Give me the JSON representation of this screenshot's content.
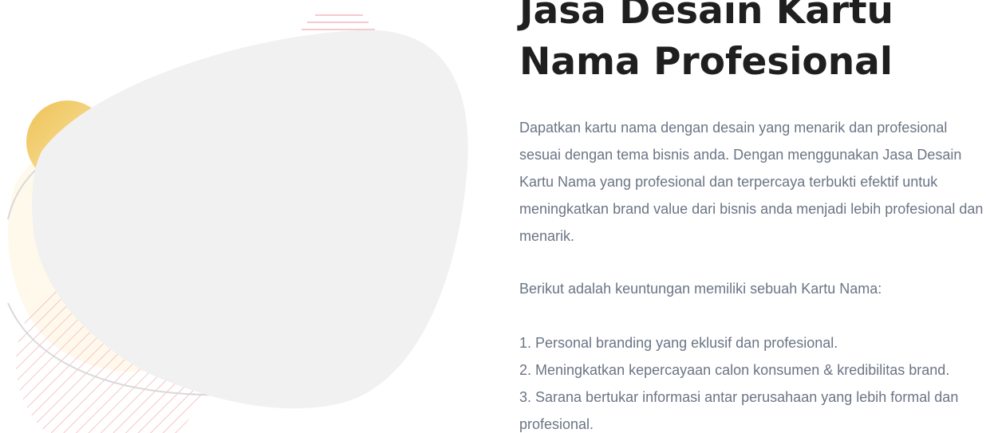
{
  "hero": {
    "title": "Jasa Desain Kartu Nama Profesional",
    "intro": "Dapatkan kartu nama dengan desain yang menarik dan profesional sesuai dengan tema bisnis anda. Dengan menggunakan Jasa Desain Kartu Nama yang profesional dan terpercaya terbukti efektif untuk meningkatkan brand value dari bisnis anda menjadi lebih profesional dan menarik.",
    "benefits_lead": "Berikut adalah keuntungan memiliki sebuah Kartu Nama:",
    "benefits": [
      "1. Personal branding yang eklusif dan profesional.",
      "2. Meningkatkan kepercayaan calon konsumen & kredibilitas brand.",
      "3. Sarana bertukar informasi antar perusahaan yang lebih formal dan profesional."
    ]
  },
  "colors": {
    "heading": "#1f1f1f",
    "body_text": "#6b7585",
    "blob": "#f1f1f1",
    "sun_gradient_start": "#f0c75a",
    "stripe_pink": "#f2b8bd",
    "arc_gray": "#d9d9d9"
  }
}
